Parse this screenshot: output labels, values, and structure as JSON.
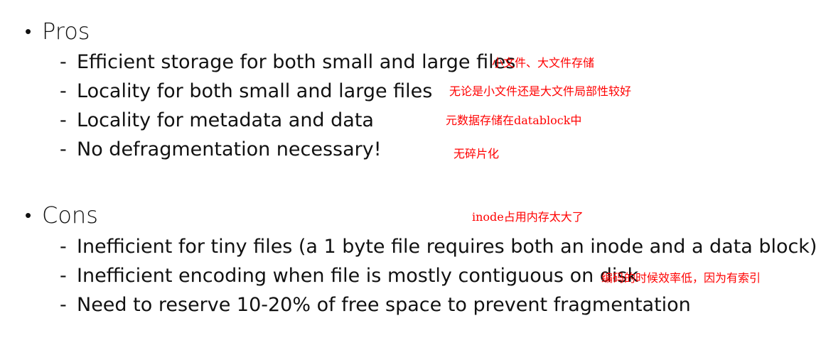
{
  "pros": {
    "bullet": "•",
    "heading": "Pros",
    "items": [
      {
        "dash": "-",
        "text": "Efficient storage for both small and large files",
        "note": "小文件、大文件存储"
      },
      {
        "dash": "-",
        "text": "Locality for both small and large files",
        "note": "无论是小文件还是大文件局部性较好"
      },
      {
        "dash": "-",
        "text": "Locality for metadata and data",
        "note": "元数据存储在datablock中"
      },
      {
        "dash": "-",
        "text": "No defragmentation necessary!",
        "note": "无碎片化"
      }
    ]
  },
  "cons": {
    "bullet": "•",
    "heading": "Cons",
    "heading_note": "inode占用内存太大了",
    "items": [
      {
        "dash": "-",
        "text": "Inefficient for tiny files (a 1 byte file requires both an inode and a data block)"
      },
      {
        "dash": "-",
        "text": "Inefficient encoding when file is mostly contiguous on disk",
        "note": "编码的时候效率低，因为有索引"
      },
      {
        "dash": "-",
        "text": "Need to reserve 10-20% of free space to prevent fragmentation"
      }
    ]
  },
  "colors": {
    "text": "#111111",
    "annotation": "#ff0000",
    "background": "#ffffff"
  }
}
